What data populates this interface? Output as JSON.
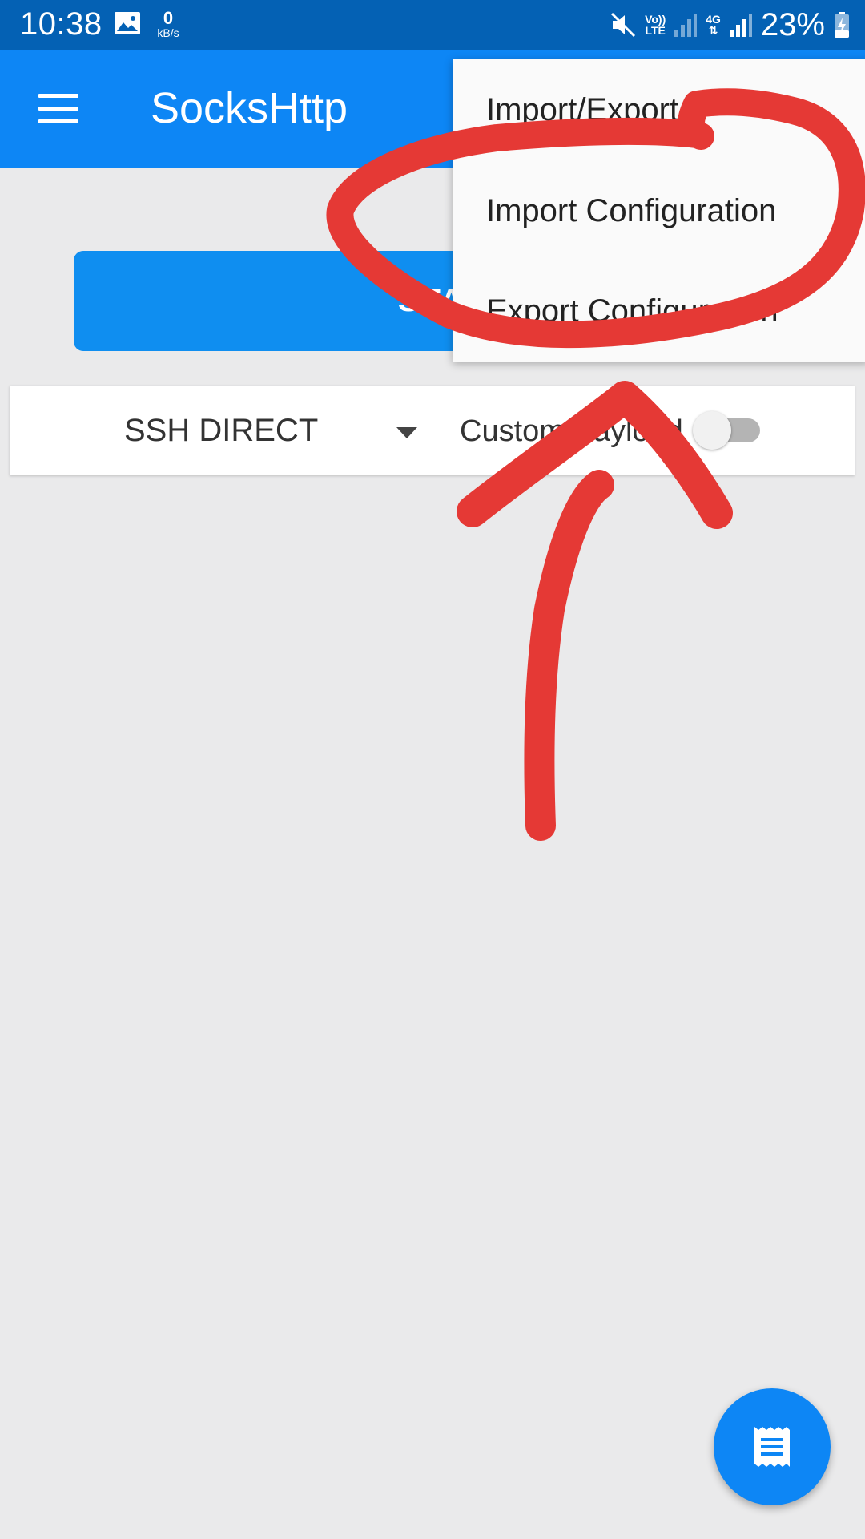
{
  "status_bar": {
    "time": "10:38",
    "speed_value": "0",
    "speed_unit": "kB/s",
    "volte_line1": "Vo))",
    "volte_line2": "LTE",
    "network_type": "4G",
    "battery_percent": "23%",
    "icons": [
      "gallery-icon",
      "mute-icon",
      "signal-icon",
      "signal-icon",
      "battery-charging-icon"
    ]
  },
  "app_bar": {
    "title": "SocksHttp",
    "menu_icon": "hamburger-menu-icon"
  },
  "main": {
    "start_label": "START",
    "connection_mode": "SSH DIRECT",
    "payload_toggle_label": "Custom Payload",
    "payload_toggle_on": false
  },
  "overflow_menu": {
    "items": [
      {
        "label": "Import/Export"
      },
      {
        "label": "Import Configuration"
      },
      {
        "label": "Export Configuration"
      }
    ]
  },
  "fab": {
    "icon": "log-receipt-icon"
  },
  "annotation": {
    "color": "#e53935"
  }
}
